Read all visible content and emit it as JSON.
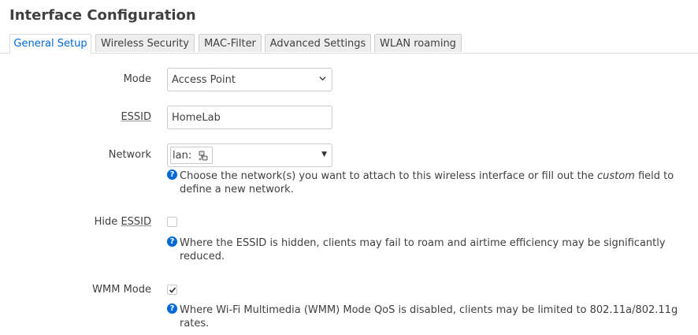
{
  "page": {
    "title": "Interface Configuration"
  },
  "tabs": [
    {
      "label": "General Setup",
      "active": true
    },
    {
      "label": "Wireless Security",
      "active": false
    },
    {
      "label": "MAC-Filter",
      "active": false
    },
    {
      "label": "Advanced Settings",
      "active": false
    },
    {
      "label": "WLAN roaming",
      "active": false
    }
  ],
  "form": {
    "mode": {
      "label": "Mode",
      "value": "Access Point"
    },
    "essid": {
      "label": "ESSID",
      "value": "HomeLab"
    },
    "network": {
      "label": "Network",
      "tag": "lan:",
      "tag_icon": "network-plug-icon",
      "help_before": "Choose the network(s) you want to attach to this wireless interface or fill out the ",
      "help_em": "custom",
      "help_after": " field to define a new network."
    },
    "hide_essid": {
      "label_prefix": "Hide ",
      "label_u": "ESSID",
      "checked": false,
      "help": "Where the ESSID is hidden, clients may fail to roam and airtime efficiency may be significantly reduced."
    },
    "wmm_mode": {
      "label": "WMM Mode",
      "checked": true,
      "help": "Where Wi-Fi Multimedia (WMM) Mode QoS is disabled, clients may be limited to 802.11a/802.11g rates."
    }
  },
  "icons": {
    "help": "help-icon",
    "help_glyph": "?",
    "accent": "#0069d6"
  }
}
